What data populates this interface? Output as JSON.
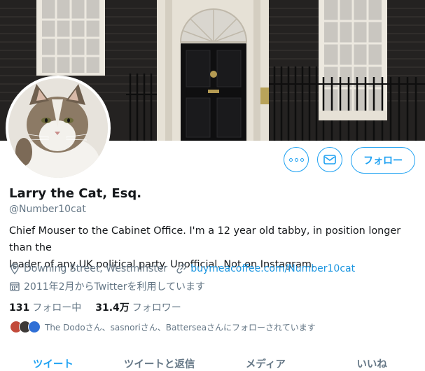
{
  "profile": {
    "name": "Larry the Cat, Esq.",
    "handle": "@Number10cat",
    "bio_line1": "Chief Mouser to the Cabinet Office. I'm a 12 year old tabby, in position longer than the",
    "bio_line2": "leader of any UK political party. Unofficial. Not on Instagram.",
    "location": "Downing Street, Westminster",
    "website": "buymeacoffee.com/Number10cat",
    "joined": "2011年2月からTwitterを利用しています",
    "following_count": "131",
    "following_label": "フォロー中",
    "followers_count": "31.4万",
    "followers_label": "フォロワー",
    "followed_by": "The Dodoさん、sasnoriさん、Batterseaさんにフォローされています"
  },
  "actions": {
    "more_icon": "more-icon",
    "message_icon": "mail-icon",
    "follow_label": "フォロー"
  },
  "tabs": [
    {
      "label": "ツイート",
      "active": true
    },
    {
      "label": "ツイートと返信",
      "active": false
    },
    {
      "label": "メディア",
      "active": false
    },
    {
      "label": "いいね",
      "active": false
    }
  ],
  "colors": {
    "accent": "#1da1f2",
    "muted": "#657786",
    "link": "#1b95e0"
  }
}
